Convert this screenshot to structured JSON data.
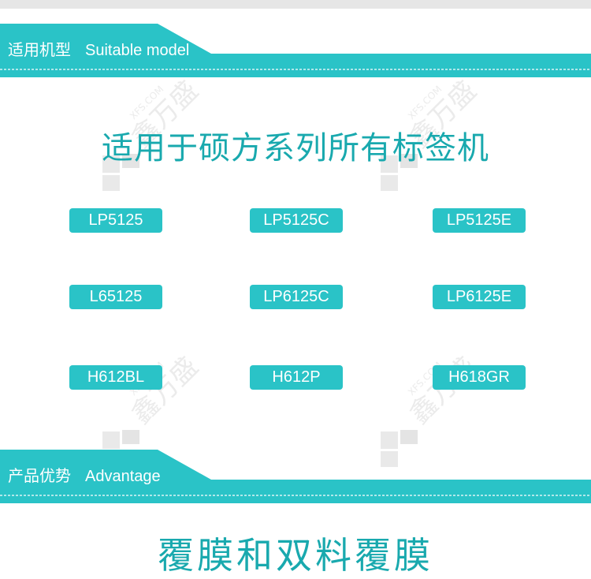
{
  "sections": {
    "suitable": {
      "title_cn": "适用机型",
      "title_en": "Suitable model"
    },
    "advantage": {
      "title_cn": "产品优势",
      "title_en": "Advantage"
    }
  },
  "headline": "适用于硕方系列所有标签机",
  "models": [
    "LP5125",
    "LP5125C",
    "LP5125E",
    "L65125",
    "LP6125C",
    "LP6125E",
    "H612BL",
    "H612P",
    "H618GR"
  ],
  "bottom_headline": "覆膜和双料覆膜",
  "watermark": {
    "brand_cn": "鑫万盛",
    "brand_en": "XFS.COM"
  },
  "colors": {
    "teal": "#2ac3c7",
    "teal_dark": "#19a9ae",
    "chip": "#2ac3c7"
  }
}
